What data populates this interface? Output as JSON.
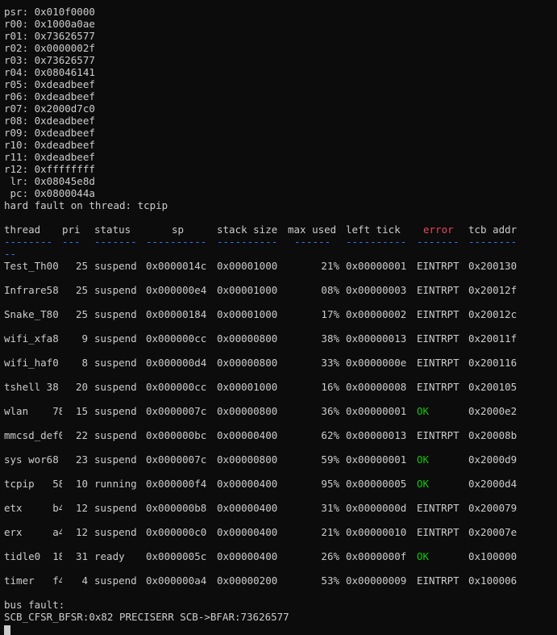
{
  "registers": [
    "psr: 0x010f0000",
    "r00: 0x1000a0ae",
    "r01: 0x73626577",
    "r02: 0x0000002f",
    "r03: 0x73626577",
    "r04: 0x08046141",
    "r05: 0xdeadbeef",
    "r06: 0xdeadbeef",
    "r07: 0x2000d7c0",
    "r08: 0xdeadbeef",
    "r09: 0xdeadbeef",
    "r10: 0xdeadbeef",
    "r11: 0xdeadbeef",
    "r12: 0xffffffff",
    " lr: 0x08045e8d",
    " pc: 0x0800044a"
  ],
  "fault_line": "hard fault on thread: tcpip",
  "headers": [
    "thread",
    "pri",
    "status",
    "sp",
    "stack size",
    "max used",
    "left tick",
    "error",
    "tcb addr"
  ],
  "dashes": [
    "-------- --",
    "---",
    "-------",
    "----------",
    "----------",
    "------",
    "----------",
    "-------",
    "--------"
  ],
  "colors": {
    "text": "#cccccc",
    "background": "#0c0c0c",
    "separator": "#3b78ff",
    "error_header": "#e74856",
    "ok": "#16c60c"
  },
  "threads": [
    {
      "name": "Test_Th00",
      "pri": "25",
      "status": "suspend",
      "sp": "0x0000014c",
      "size": "0x00001000",
      "used": "21%",
      "tick": "0x00000001",
      "error": "EINTRPT",
      "addr": "0x200130"
    },
    {
      "name": "Infrare58",
      "pri": "25",
      "status": "suspend",
      "sp": "0x000000e4",
      "size": "0x00001000",
      "used": "08%",
      "tick": "0x00000003",
      "error": "EINTRPT",
      "addr": "0x20012f"
    },
    {
      "name": "Snake_T80",
      "pri": "25",
      "status": "suspend",
      "sp": "0x00000184",
      "size": "0x00001000",
      "used": "17%",
      "tick": "0x00000002",
      "error": "EINTRPT",
      "addr": "0x20012c"
    },
    {
      "name": "wifi_xfa8",
      "pri": "9",
      "status": "suspend",
      "sp": "0x000000cc",
      "size": "0x00000800",
      "used": "38%",
      "tick": "0x00000013",
      "error": "EINTRPT",
      "addr": "0x20011f"
    },
    {
      "name": "wifi_haf0",
      "pri": "8",
      "status": "suspend",
      "sp": "0x000000d4",
      "size": "0x00000800",
      "used": "33%",
      "tick": "0x0000000e",
      "error": "EINTRPT",
      "addr": "0x200116"
    },
    {
      "name": "tshell 38",
      "pri": "20",
      "status": "suspend",
      "sp": "0x000000cc",
      "size": "0x00001000",
      "used": "16%",
      "tick": "0x00000008",
      "error": "EINTRPT",
      "addr": "0x200105"
    },
    {
      "name": "wlan    78",
      "pri": "15",
      "status": "suspend",
      "sp": "0x0000007c",
      "size": "0x00000800",
      "used": "36%",
      "tick": "0x00000001",
      "error": "OK",
      "addr": "0x2000e2"
    },
    {
      "name": "mmcsd_def0",
      "pri": "22",
      "status": "suspend",
      "sp": "0x000000bc",
      "size": "0x00000400",
      "used": "62%",
      "tick": "0x00000013",
      "error": "EINTRPT",
      "addr": "0x20008b"
    },
    {
      "name": "sys wor68",
      "pri": "23",
      "status": "suspend",
      "sp": "0x0000007c",
      "size": "0x00000800",
      "used": "59%",
      "tick": "0x00000001",
      "error": "OK",
      "addr": "0x2000d9"
    },
    {
      "name": "tcpip   58",
      "pri": "10",
      "status": "running",
      "sp": "0x000000f4",
      "size": "0x00000400",
      "used": "95%",
      "tick": "0x00000005",
      "error": "OK",
      "addr": "0x2000d4"
    },
    {
      "name": "etx     b4",
      "pri": "12",
      "status": "suspend",
      "sp": "0x000000b8",
      "size": "0x00000400",
      "used": "31%",
      "tick": "0x0000000d",
      "error": "EINTRPT",
      "addr": "0x200079"
    },
    {
      "name": "erx     a4",
      "pri": "12",
      "status": "suspend",
      "sp": "0x000000c0",
      "size": "0x00000400",
      "used": "21%",
      "tick": "0x00000010",
      "error": "EINTRPT",
      "addr": "0x20007e"
    },
    {
      "name": "tidle0  18",
      "pri": "31",
      "status": "ready",
      "sp": "0x0000005c",
      "size": "0x00000400",
      "used": "26%",
      "tick": "0x0000000f",
      "error": "OK",
      "addr": "0x100000"
    },
    {
      "name": "timer   f4",
      "pri": "4",
      "status": "suspend",
      "sp": "0x000000a4",
      "size": "0x00000200",
      "used": "53%",
      "tick": "0x00000009",
      "error": "EINTRPT",
      "addr": "0x100006"
    }
  ],
  "bus_fault_label": "bus fault:",
  "bus_fault_detail": "SCB_CFSR_BFSR:0x82 PRECISERR SCB->BFAR:73626577"
}
